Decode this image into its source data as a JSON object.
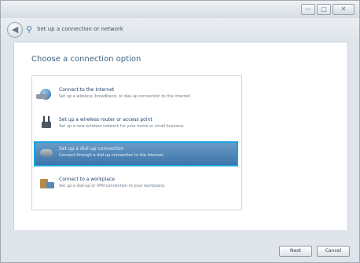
{
  "window": {
    "title_controls": {
      "minimize": "—",
      "maximize": "□",
      "close": "✕"
    }
  },
  "nav": {
    "back_glyph": "◀",
    "title_icon": "network-icon",
    "title": "Set up a connection or network"
  },
  "page": {
    "heading": "Choose a connection option"
  },
  "options": [
    {
      "title": "Connect to the Internet",
      "description": "Set up a wireless, broadband, or dial-up connection to the Internet.",
      "icon": "globe-icon",
      "selected": false
    },
    {
      "title": "Set up a wireless router or access point",
      "description": "Set up a new wireless network for your home or small business.",
      "icon": "router-icon",
      "selected": false
    },
    {
      "title": "Set up a dial-up connection",
      "description": "Connect through a dial-up connection to the Internet.",
      "icon": "modem-icon",
      "selected": true
    },
    {
      "title": "Connect to a workplace",
      "description": "Set up a dial-up or VPN connection to your workplace.",
      "icon": "workplace-icon",
      "selected": false
    }
  ],
  "footer": {
    "next_label": "Next",
    "cancel_label": "Cancel"
  },
  "colors": {
    "selection": "#3d74aa",
    "focus_border": "#18a4dc"
  }
}
